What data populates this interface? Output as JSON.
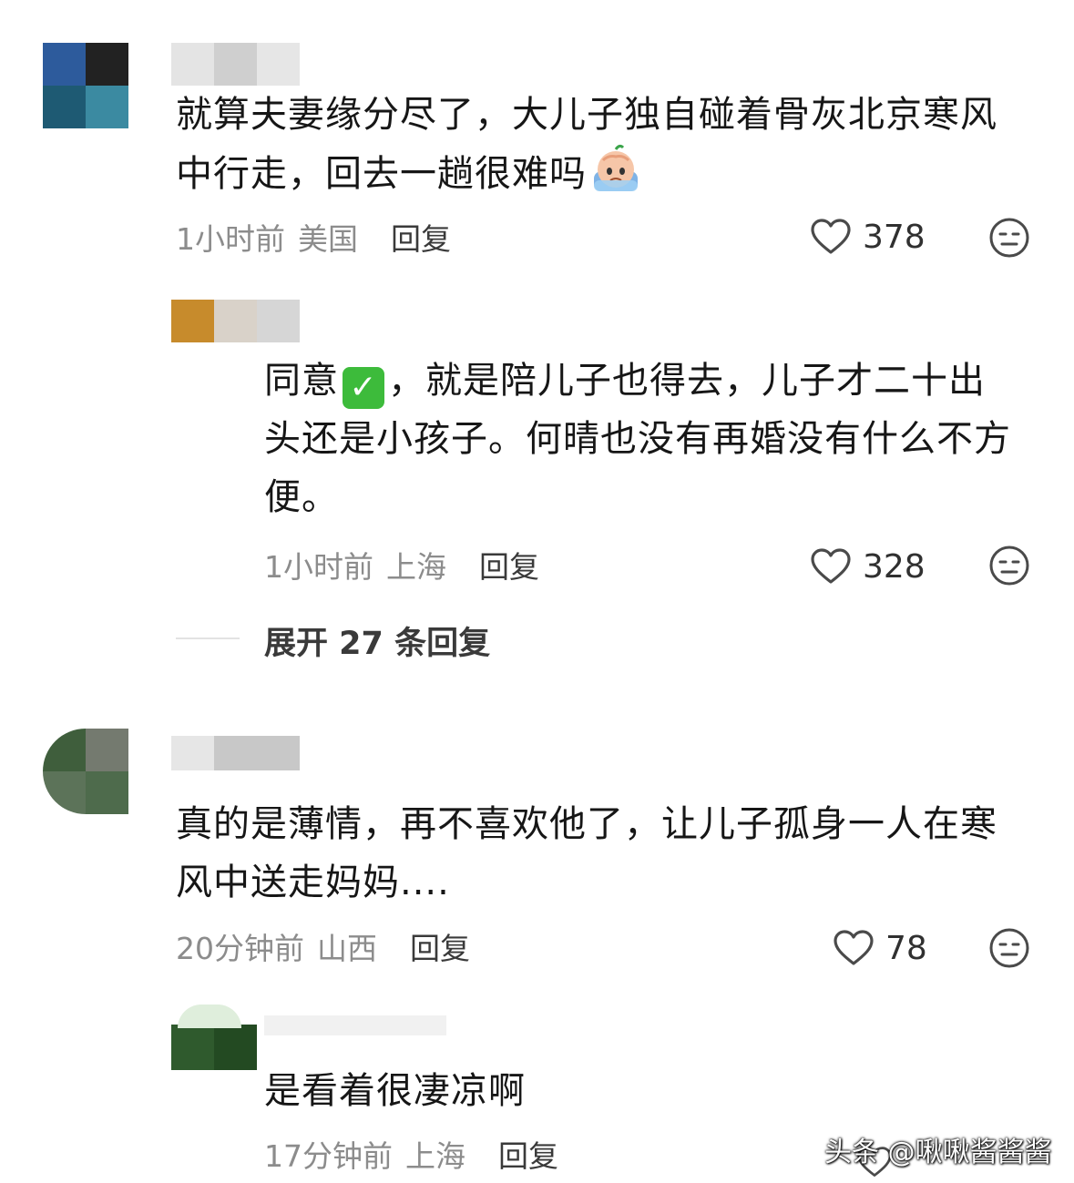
{
  "comments": [
    {
      "text_line1": "就算夫妻缘分尽了，大儿子独自碰着骨灰北京寒风",
      "text_line2": "中行走，回去一趟很难吗",
      "time": "1小时前",
      "location": "美国",
      "reply_label": "回复",
      "likes": "378",
      "emoji": "crying-face"
    },
    {
      "text_line1_a": "同意",
      "text_line1_b": "，就是陪儿子也得去，儿子才二十出",
      "text_line2": "头还是小孩子。何晴也没有再婚没有什么不方",
      "text_line3": "便。",
      "time": "1小时前",
      "location": "上海",
      "reply_label": "回复",
      "likes": "328",
      "emoji": "check-mark"
    },
    {
      "text_line1": "真的是薄情，再不喜欢他了，让儿子孤身一人在寒",
      "text_line2": "风中送走妈妈....",
      "time": "20分钟前",
      "location": "山西",
      "reply_label": "回复",
      "likes": "78"
    },
    {
      "text_line1": "是看着很凄凉啊",
      "time": "17分钟前",
      "location": "上海",
      "reply_label": "回复"
    }
  ],
  "expand_replies": "展开 27 条回复",
  "watermark": "头条 @啾啾酱酱酱",
  "icons": {
    "like": "heart-outline-icon",
    "reaction": "meh-face-icon"
  },
  "colors": {
    "text": "#161616",
    "meta": "#8c8c8c",
    "icon": "#4a4a4a"
  }
}
